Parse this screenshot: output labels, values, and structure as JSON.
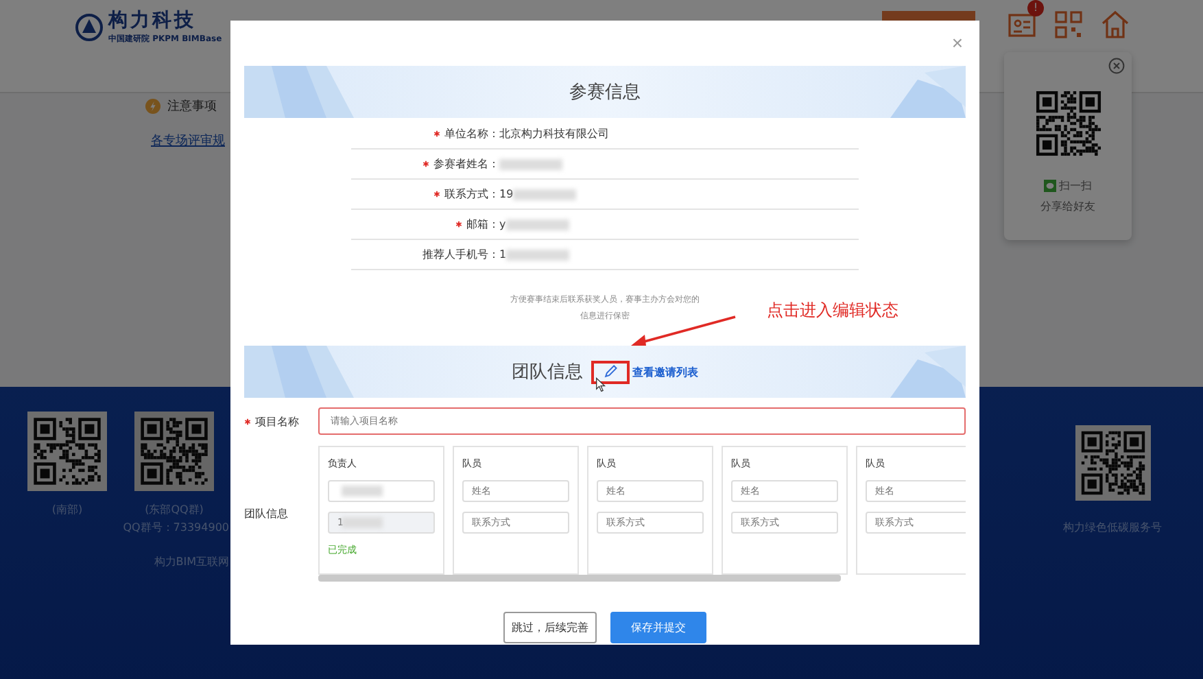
{
  "header": {
    "logo_name": "构力科技",
    "logo_sub": "中国建研院 PKPM BIMBase",
    "badge": "!"
  },
  "notice": {
    "title": "注意事项",
    "link": "各专场评审规"
  },
  "share_popup": {
    "scan": "扫一扫",
    "share": "分享给好友"
  },
  "footer": {
    "qr_codes": [
      {
        "caption": "(南部)"
      },
      {
        "caption": "(东部QQ群)"
      }
    ],
    "qq_number": "QQ群号：73394900",
    "bottom_text": "构力BIM互联网",
    "service_caption": "构力绿色低碳服务号"
  },
  "modal": {
    "close": "×",
    "participant": {
      "title": "参赛信息",
      "fields": [
        {
          "label": "单位名称：",
          "required": true,
          "value": "北京构力科技有限公司"
        },
        {
          "label": "参赛者姓名：",
          "required": true,
          "blurred": true
        },
        {
          "label": "联系方式：",
          "required": true,
          "value": "19",
          "blurred": true
        },
        {
          "label": "邮箱：",
          "required": true,
          "value": "y",
          "blurred": true
        },
        {
          "label": "推荐人手机号：",
          "value": "1",
          "blurred": true
        }
      ],
      "note": "方便赛事结束后联系获奖人员，赛事主办方会对您的信息进行保密"
    },
    "annotation": "点击进入编辑状态",
    "team": {
      "title": "团队信息",
      "invite_link": "查看邀请列表",
      "project_label": "项目名称",
      "project_required": true,
      "project_placeholder": "请输入项目名称",
      "team_label": "团队信息",
      "members": [
        {
          "role": "负责人",
          "name_blurred": true,
          "phone_value": "1",
          "phone_blurred": true,
          "phone_disabled": true,
          "status": "已完成"
        },
        {
          "role": "队员",
          "name_placeholder": "姓名",
          "phone_placeholder": "联系方式",
          "phone_disabled": false
        },
        {
          "role": "队员",
          "name_placeholder": "姓名",
          "phone_placeholder": "联系方式",
          "phone_disabled": false
        },
        {
          "role": "队员",
          "name_placeholder": "姓名",
          "phone_placeholder": "联系方式",
          "phone_disabled": false
        },
        {
          "role": "队员",
          "name_placeholder": "姓名",
          "phone_placeholder": "联系方式",
          "phone_disabled": false
        }
      ]
    },
    "buttons": [
      {
        "label": "跳过，后续完善",
        "kind": "default"
      },
      {
        "label": "保存并提交",
        "kind": "primary"
      }
    ]
  }
}
